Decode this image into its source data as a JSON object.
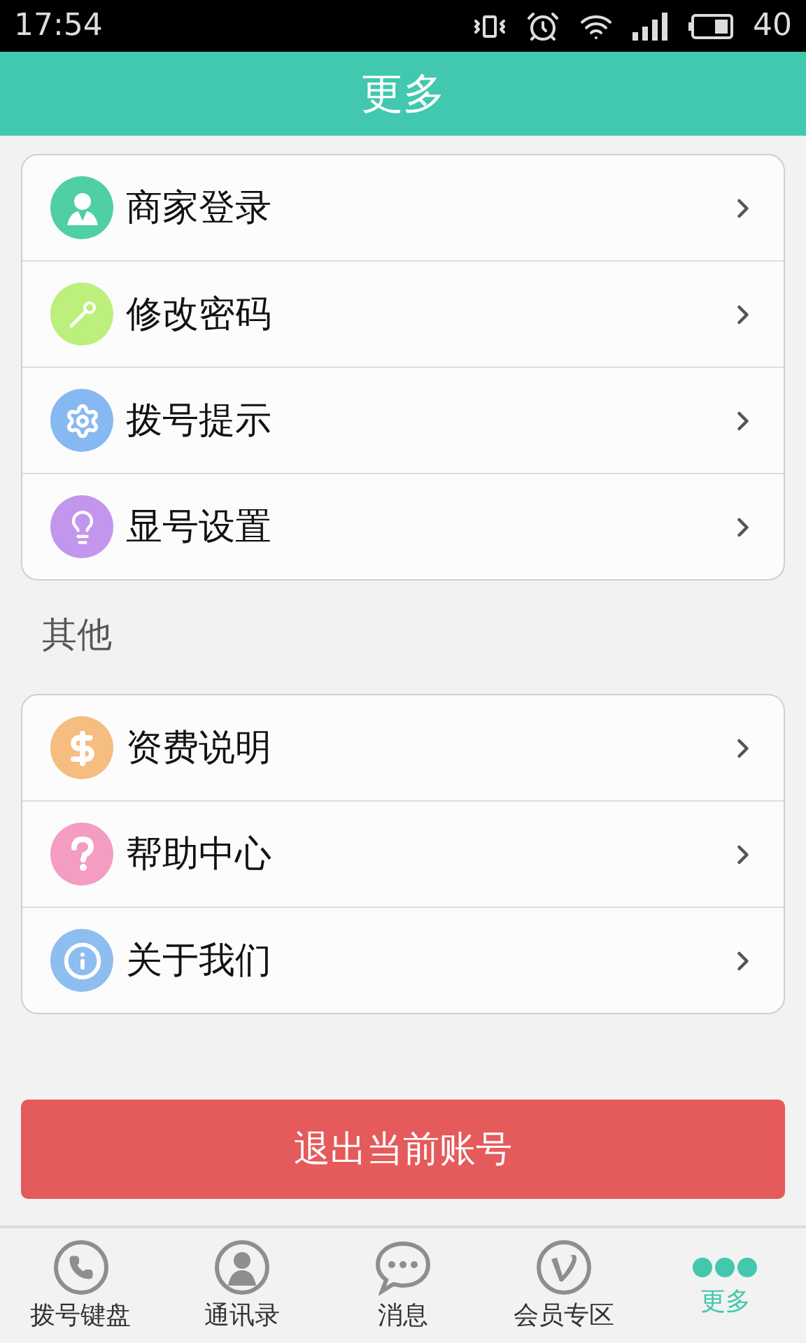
{
  "status_bar": {
    "time": "17:54",
    "battery": "40"
  },
  "header": {
    "title": "更多"
  },
  "groups": [
    {
      "items": [
        {
          "label": "商家登录",
          "kind": "person",
          "color": "#4fcfa3"
        },
        {
          "label": "修改密码",
          "kind": "key",
          "color": "#bdef7c"
        },
        {
          "label": "拨号提示",
          "kind": "gear",
          "color": "#86b8f2"
        },
        {
          "label": "显号设置",
          "kind": "bulb",
          "color": "#c396ee"
        }
      ]
    },
    {
      "title": "其他",
      "items": [
        {
          "label": "资费说明",
          "kind": "dollar",
          "color": "#f5bd7f"
        },
        {
          "label": "帮助中心",
          "kind": "question",
          "color": "#f49cc1"
        },
        {
          "label": "关于我们",
          "kind": "info",
          "color": "#8ebdf0"
        }
      ]
    }
  ],
  "logout_button": "退出当前账号",
  "tabs": [
    {
      "label": "拨号键盘",
      "kind": "phone",
      "selected": false
    },
    {
      "label": "通讯录",
      "kind": "contact",
      "selected": false
    },
    {
      "label": "消息",
      "kind": "chat",
      "selected": false
    },
    {
      "label": "会员专区",
      "kind": "vip",
      "selected": false
    },
    {
      "label": "更多",
      "kind": "dots",
      "selected": true
    }
  ]
}
